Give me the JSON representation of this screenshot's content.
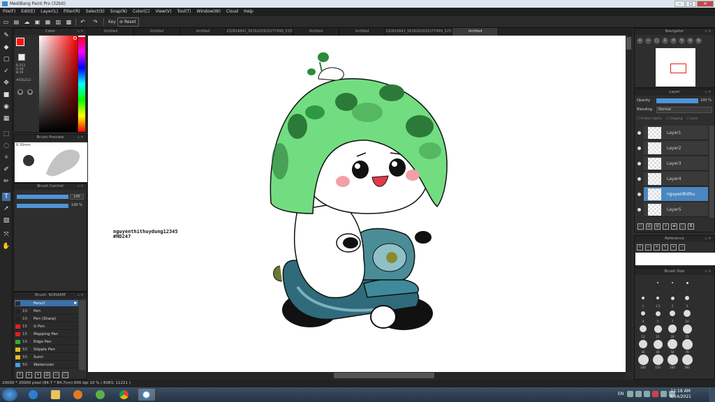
{
  "title": "MediBang Paint Pro (32bit)",
  "menu": [
    "File(F)",
    "Edit(E)",
    "Layer(L)",
    "Filter(R)",
    "Select(S)",
    "Snap(N)",
    "Color(C)",
    "View(V)",
    "Tool(T)",
    "Window(W)",
    "Cloud",
    "Help"
  ],
  "toolbar": {
    "key_label": "Key",
    "reset_label": "Reset"
  },
  "color_panel": {
    "title": "Color",
    "fg_color": "#FD1213",
    "r": "R:253",
    "g": "G:18",
    "b": "B:19",
    "hex": "#FD1213"
  },
  "brush_preview": {
    "title": "Brush Preview",
    "size": "8.30mm"
  },
  "brush_control": {
    "title": "Brush Control",
    "size_value": "145",
    "opacity_value": "100 %"
  },
  "brush_list": {
    "title": "Brush: NONAME",
    "items": [
      {
        "num": "",
        "name": "Pencil",
        "color": "#2a2a2a",
        "selected": true
      },
      {
        "num": "10",
        "name": "Pen",
        "color": "#222222"
      },
      {
        "num": "10",
        "name": "Pen (Sharp)",
        "color": "#222222"
      },
      {
        "num": "15",
        "name": "G Pen",
        "color": "#e02020"
      },
      {
        "num": "15",
        "name": "Mapping Pen",
        "color": "#e02020"
      },
      {
        "num": "10",
        "name": "Edge Pen",
        "color": "#30b030"
      },
      {
        "num": "50",
        "name": "Stipple Pen",
        "color": "#e0c020"
      },
      {
        "num": "50",
        "name": "Sumi",
        "color": "#e0c020"
      },
      {
        "num": "50",
        "name": "Watercolor",
        "color": "#40a0e0"
      }
    ]
  },
  "tabs": [
    {
      "label": "Untitled"
    },
    {
      "label": "Untitled"
    },
    {
      "label": "Untitled"
    },
    {
      "label": "232814841_5616202915277499_5255071339365941883_n.png",
      "wide": true
    },
    {
      "label": "Untitled"
    },
    {
      "label": "Untitled"
    },
    {
      "label": "232814841_5616202915277499_5255071339365941883_n.png",
      "wide": true
    },
    {
      "label": "Untitled",
      "active": true
    }
  ],
  "canvas": {
    "signature_line1": "nguyenthithuydung12345",
    "signature_line2": "#HD247"
  },
  "navigator": {
    "title": "Navigator"
  },
  "layer_panel": {
    "title": "Layer",
    "opacity_label": "Opacity",
    "opacity_value": "100 %",
    "blending_label": "Blending",
    "blending_value": "Normal",
    "protect_alpha": "Protect Alpha",
    "clipping": "Clipping",
    "lock": "Lock",
    "layers": [
      {
        "name": "Layer1"
      },
      {
        "name": "Layer2"
      },
      {
        "name": "Layer3"
      },
      {
        "name": "Layer4"
      },
      {
        "name": "nguyenthithu",
        "selected": true
      },
      {
        "name": "Layer5"
      }
    ]
  },
  "reference": {
    "title": "Reference"
  },
  "brush_size": {
    "title": "Brush Size",
    "rows": [
      [
        "",
        ".",
        ".",
        "."
      ],
      [
        "1",
        "1.5",
        "2",
        "3"
      ],
      [
        "4",
        "5",
        "7",
        "10"
      ],
      [
        "12",
        "15",
        "20",
        "25"
      ],
      [
        "30",
        "40",
        "50",
        "70"
      ],
      [
        "100",
        "150",
        "200",
        "300"
      ]
    ]
  },
  "status": "20000 * 20000 pixel  (84.7 * 84.7cm)  600 dpi  10 %  ( 8083, 11221 )",
  "taskbar": {
    "lang": "EN",
    "time": "11:18 AM",
    "date": "8/14/2021"
  }
}
